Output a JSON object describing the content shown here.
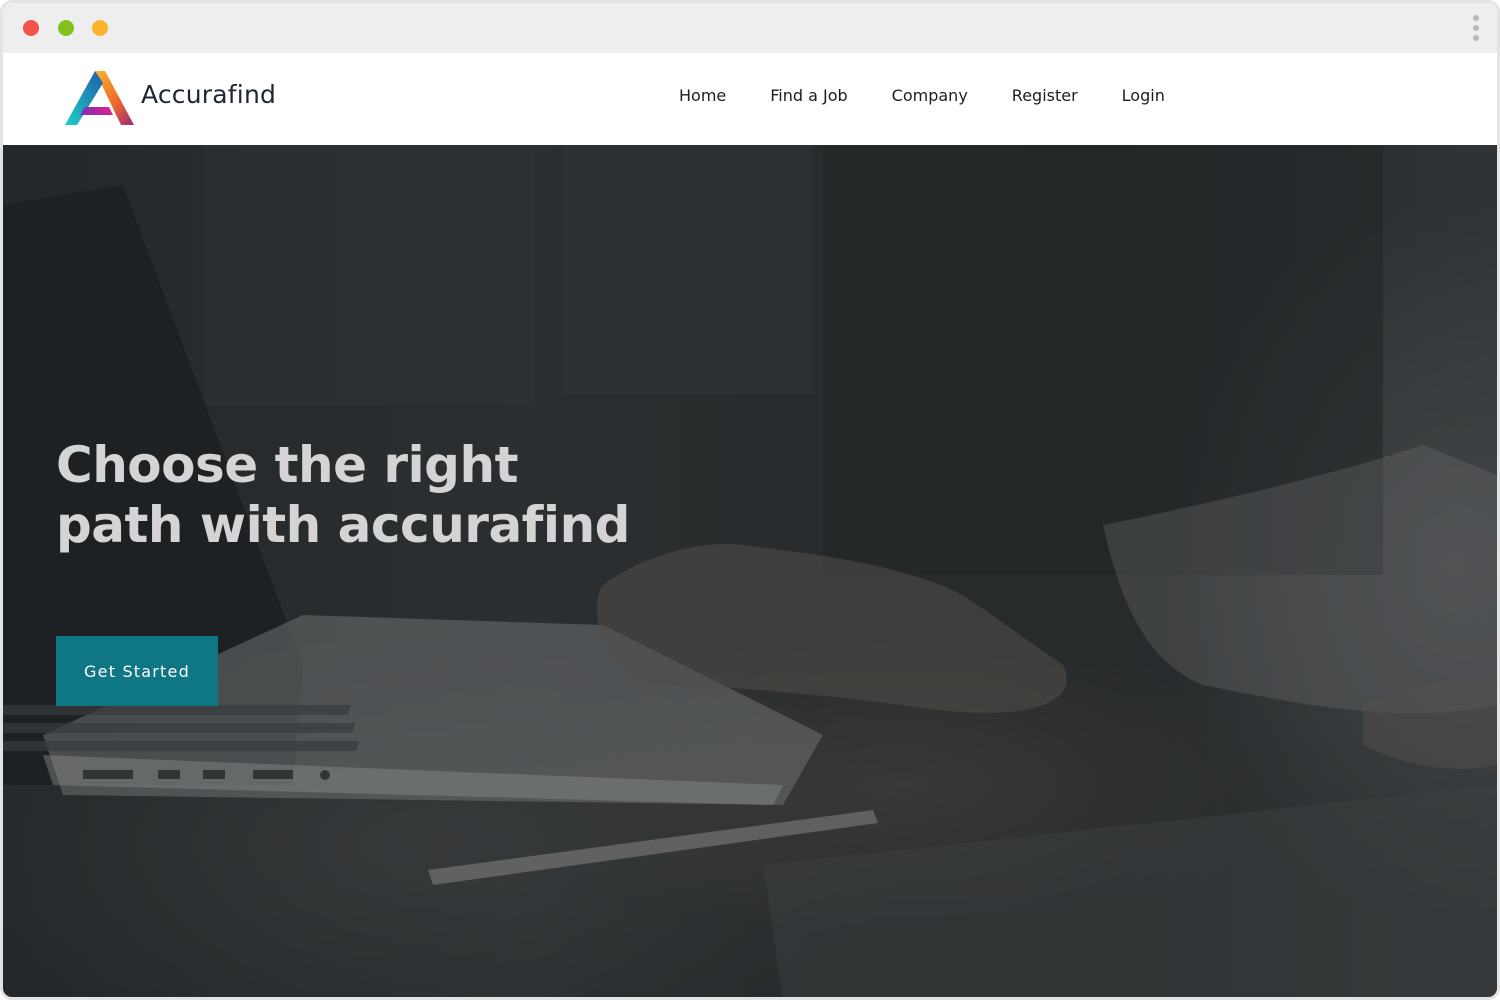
{
  "browser": {
    "traffic_lights": {
      "red": "#f2534b",
      "green": "#85c11e",
      "yellow": "#f8b42c"
    },
    "menu_icon": "kebab-menu-icon"
  },
  "brand": {
    "name": "Accurafind",
    "logo_icon": "triangle-a-logo-icon"
  },
  "nav": {
    "items": [
      {
        "label": "Home"
      },
      {
        "label": "Find a Job"
      },
      {
        "label": "Company"
      },
      {
        "label": "Register"
      },
      {
        "label": "Login"
      }
    ]
  },
  "hero": {
    "title_line1": "Choose the right",
    "title_line2": "path with accurafind",
    "cta_label": "Get Started",
    "accent_color": "#0f7683"
  }
}
